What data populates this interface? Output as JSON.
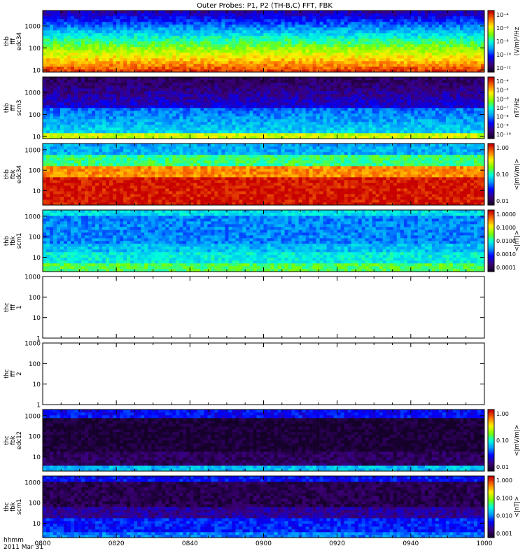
{
  "title": "Outer Probes: P1, P2 (TH-B,C) FFT, FBK",
  "footer": {
    "axis_label_line1": "hhmm",
    "axis_label_line2": "2011 Mar 31"
  },
  "chart_data": {
    "type": "heatmap",
    "x_axis": {
      "label": "hhmm",
      "date": "2011 Mar 31",
      "range": [
        "0800",
        "1000"
      ],
      "ticks": [
        "0800",
        "0820",
        "0840",
        "0900",
        "0920",
        "0940",
        "1000"
      ]
    },
    "panels": [
      {
        "id": "thb_fff_edc34",
        "ylabel": [
          "thb",
          "fff",
          "edc34"
        ],
        "yscale": "log",
        "ylim": [
          8,
          5000
        ],
        "yticks": [
          "10",
          "100",
          "1000"
        ],
        "colorbar": {
          "label": "(V/m)²/Hz",
          "scale": "log",
          "ticks": [
            "10⁻⁴",
            "10⁻⁶",
            "10⁻⁸",
            "10⁻¹⁰",
            "10⁻¹²"
          ],
          "range": [
            "1e-12",
            "1e-4"
          ]
        },
        "has_data": true
      },
      {
        "id": "thb_fff_scm3",
        "ylabel": [
          "thb",
          "fff",
          "scm3"
        ],
        "yscale": "log",
        "ylim": [
          8,
          5000
        ],
        "yticks": [
          "10",
          "100",
          "1000"
        ],
        "colorbar": {
          "label": "nT²/Hz",
          "scale": "log",
          "ticks": [
            "10⁻⁴",
            "10⁻⁵",
            "10⁻⁶",
            "10⁻⁷",
            "10⁻⁸",
            "10⁻⁹",
            "10⁻¹⁰"
          ],
          "range": [
            "1e-10",
            "1e-4"
          ]
        },
        "has_data": true
      },
      {
        "id": "thb_fbk_edc34",
        "ylabel": [
          "thb",
          "fbk",
          "edc34"
        ],
        "yscale": "log",
        "ylim": [
          2,
          2000
        ],
        "yticks": [
          "10",
          "100",
          "1000"
        ],
        "colorbar": {
          "label": "<|mV/m|>",
          "scale": "log",
          "ticks": [
            "1.00",
            "0.10",
            "0.01"
          ],
          "range": [
            "0.005",
            "2"
          ]
        },
        "has_data": true
      },
      {
        "id": "thb_fbk_scm1",
        "ylabel": [
          "thb",
          "fbk",
          "scm1"
        ],
        "yscale": "log",
        "ylim": [
          2,
          2000
        ],
        "yticks": [
          "10",
          "100",
          "1000"
        ],
        "colorbar": {
          "label": "<|nT|>",
          "scale": "log",
          "ticks": [
            "1.0000",
            "0.1000",
            "0.0100",
            "0.0010",
            "0.0001"
          ],
          "range": [
            "0.00003",
            "1.5"
          ]
        },
        "has_data": true
      },
      {
        "id": "thc_fff_1",
        "ylabel": [
          "thc",
          "fff",
          "1"
        ],
        "yscale": "log",
        "ylim": [
          1,
          1000
        ],
        "yticks": [
          "1",
          "10",
          "100",
          "1000"
        ],
        "colorbar": null,
        "has_data": false
      },
      {
        "id": "thc_fff_2",
        "ylabel": [
          "thc",
          "fff",
          "2"
        ],
        "yscale": "log",
        "ylim": [
          1,
          1000
        ],
        "yticks": [
          "1",
          "10",
          "100",
          "1000"
        ],
        "colorbar": null,
        "has_data": false
      },
      {
        "id": "thc_fbk_edc12",
        "ylabel": [
          "thc",
          "fbk",
          "edc12"
        ],
        "yscale": "log",
        "ylim": [
          2,
          2000
        ],
        "yticks": [
          "10",
          "100",
          "1000"
        ],
        "colorbar": {
          "label": "<|mV/m|>",
          "scale": "log",
          "ticks": [
            "1.00",
            "0.10",
            "0.01"
          ],
          "range": [
            "0.005",
            "2"
          ]
        },
        "has_data": true
      },
      {
        "id": "thc_fbk_scm1",
        "ylabel": [
          "thc",
          "fbk",
          "scm1"
        ],
        "yscale": "log",
        "ylim": [
          2,
          2000
        ],
        "yticks": [
          "10",
          "100",
          "1000"
        ],
        "colorbar": {
          "label": "<|nT|>",
          "scale": "log",
          "ticks": [
            "1.000",
            "0.100",
            "0.010",
            "0.001"
          ],
          "range": [
            "0.0007",
            "1.5"
          ]
        },
        "has_data": true
      }
    ]
  }
}
